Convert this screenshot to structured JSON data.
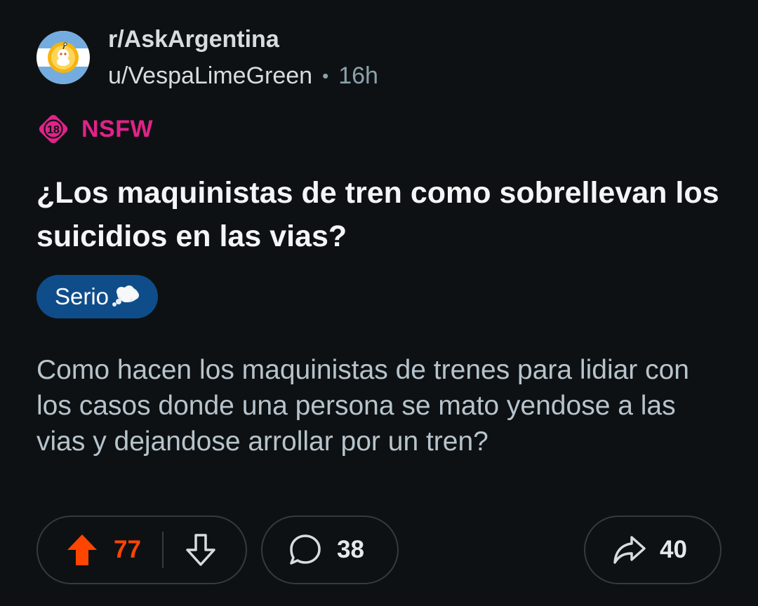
{
  "post": {
    "subreddit": "r/AskArgentina",
    "author": "u/VespaLimeGreen",
    "separator": "•",
    "time": "16h",
    "nsfw_number": "18",
    "nsfw_label": "NSFW",
    "title": "¿Los maquinistas de tren como sobrellevan los suicidios en las vias?",
    "flair": {
      "text": "Serio",
      "emoji": "thought-balloon-icon",
      "color": "#0f4d8a"
    },
    "body": "Como hacen los maquinistas de trenes para lidiar con los casos donde una persona se mato yendose a las vias y dejandose arrollar por un tren?"
  },
  "actions": {
    "upvotes": "77",
    "upvote_state": "upvoted",
    "upvote_color": "#ff4500",
    "comments": "38",
    "shares": "40",
    "icons": [
      "upvote-arrow-icon",
      "downvote-arrow-icon",
      "comment-bubble-icon",
      "share-arrow-icon"
    ]
  },
  "colors": {
    "background": "#0e1113",
    "nsfw": "#e1228a",
    "body_text": "#b7c4cc"
  }
}
